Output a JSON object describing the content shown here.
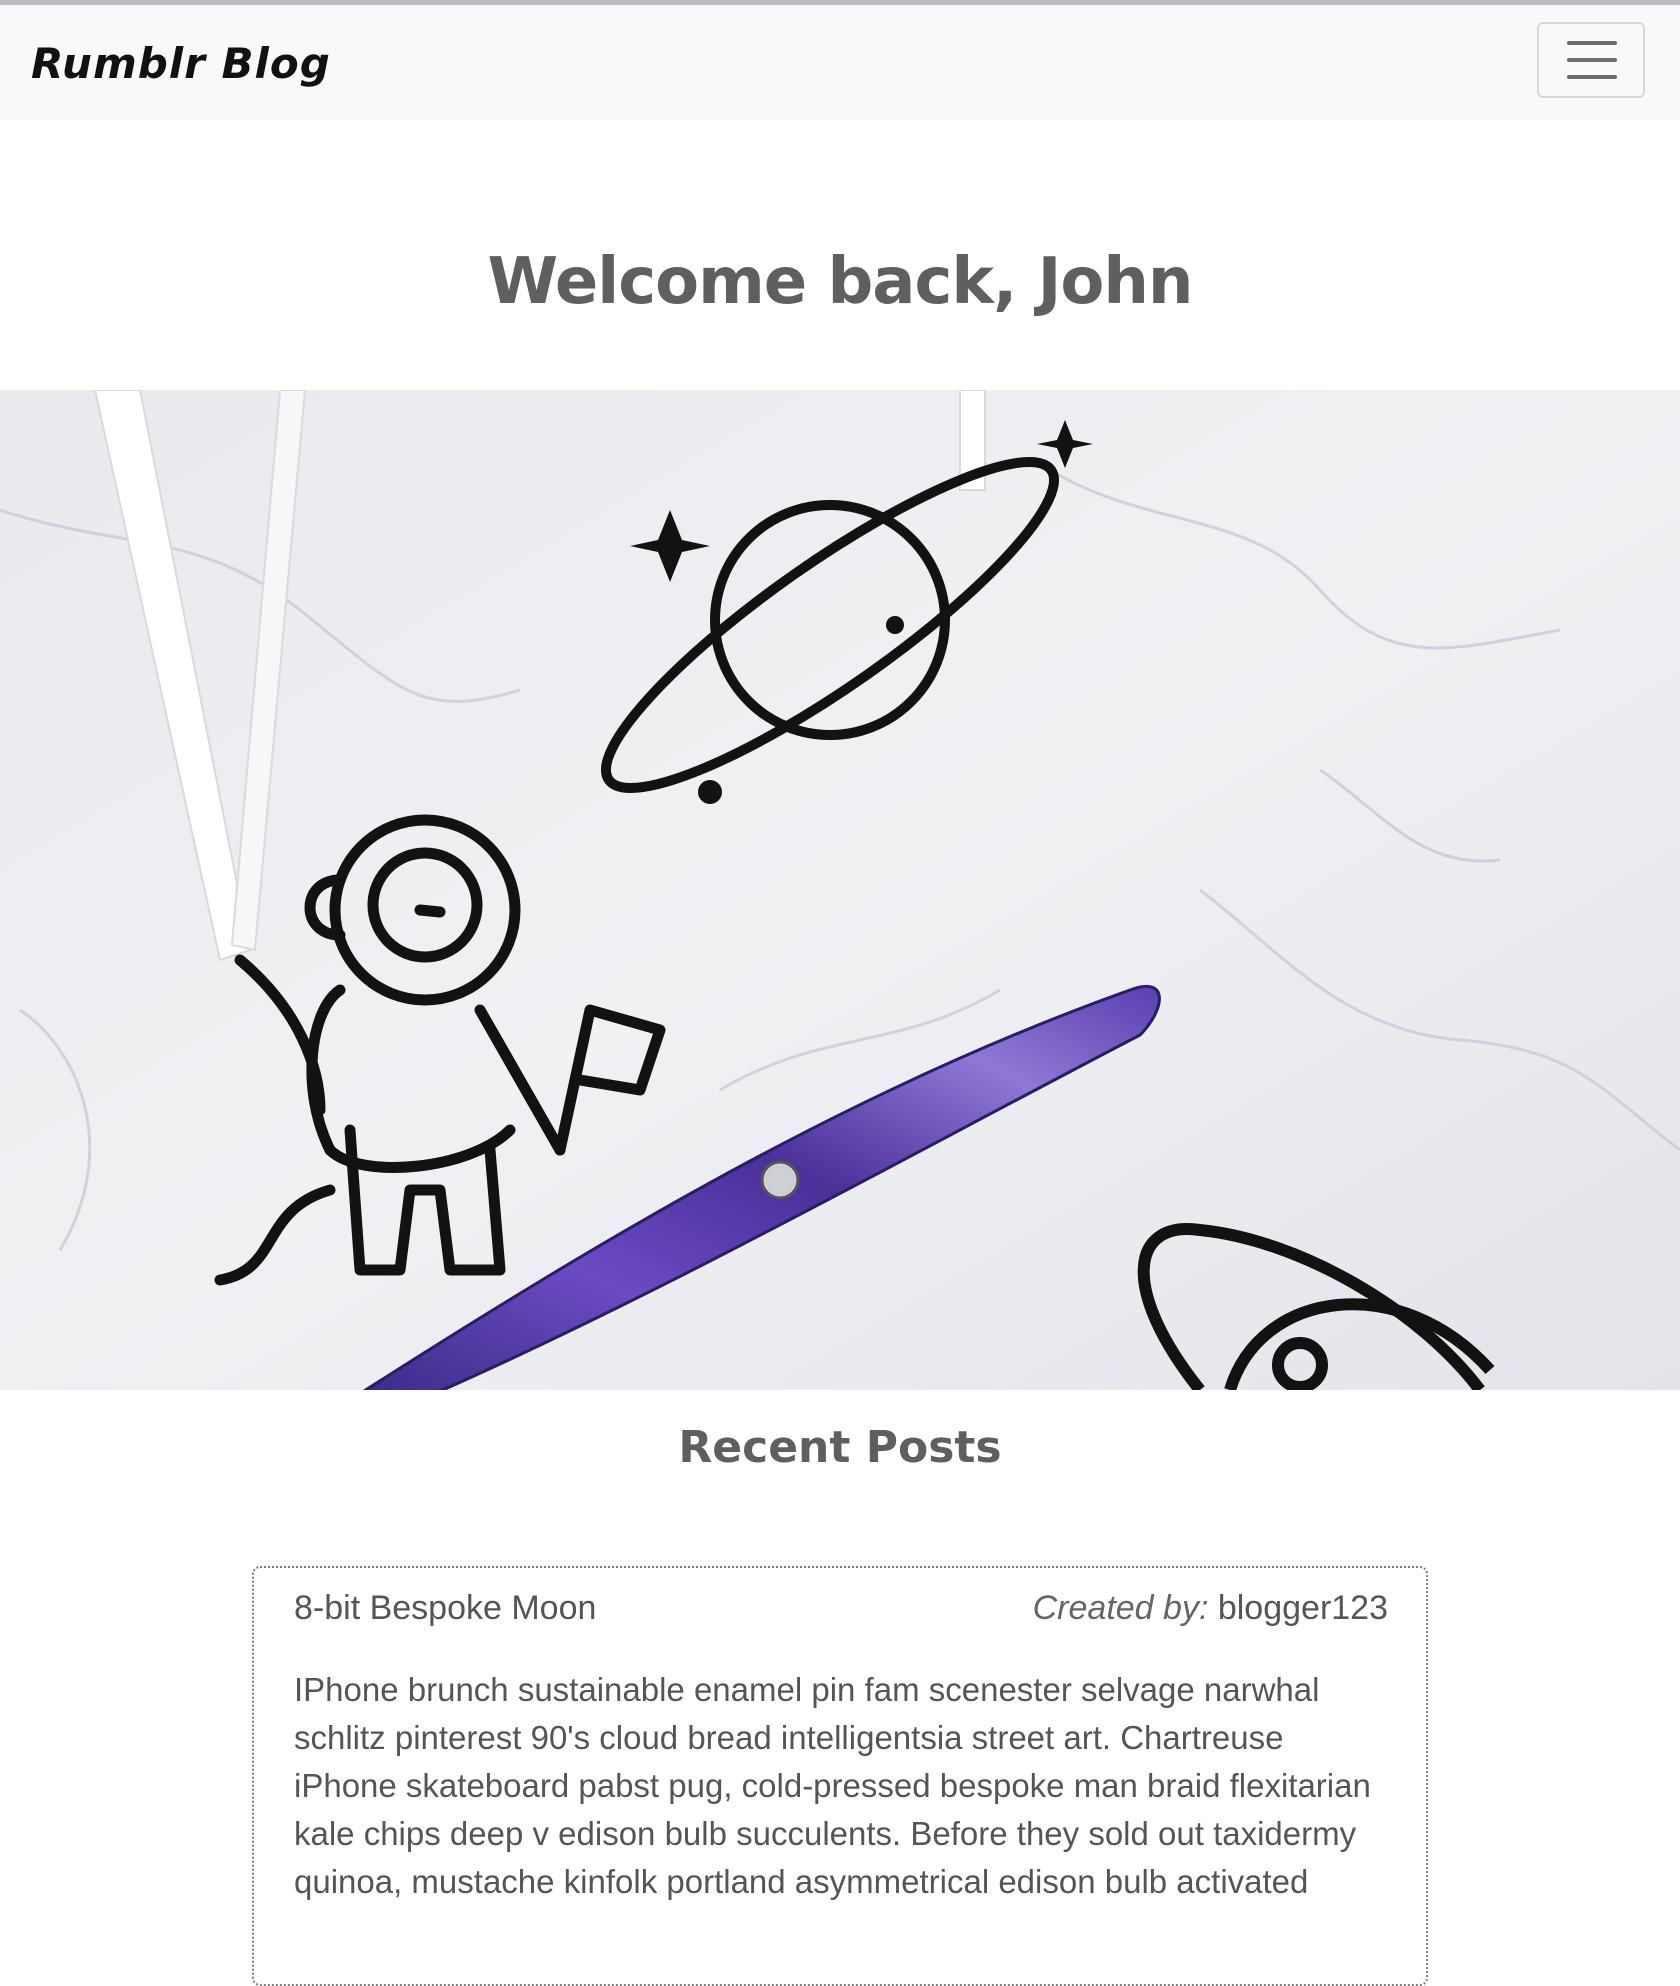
{
  "navbar": {
    "brand": "Rumblr Blog",
    "menu_icon": "hamburger-menu-icon"
  },
  "welcome": {
    "heading": "Welcome back, John"
  },
  "hero": {
    "image_icon": "space-themed-bookmarks-and-pen-photo"
  },
  "recent_posts": {
    "heading": "Recent Posts",
    "posts": [
      {
        "title": "8-bit Bespoke Moon",
        "created_by_label": "Created by:",
        "author": "blogger123",
        "body": "IPhone brunch sustainable enamel pin fam scenester selvage narwhal schlitz pinterest 90's cloud bread intelligentsia street art. Chartreuse iPhone skateboard pabst pug, cold-pressed bespoke man braid flexitarian kale chips deep v edison bulb succulents. Before they sold out taxidermy quinoa, mustache kinfolk portland asymmetrical edison bulb activated"
      }
    ]
  },
  "colors": {
    "navbar_bg": "#f8f9fa",
    "heading_text": "#5f5f5f",
    "body_text": "#555555",
    "card_border": "#777a7e"
  }
}
